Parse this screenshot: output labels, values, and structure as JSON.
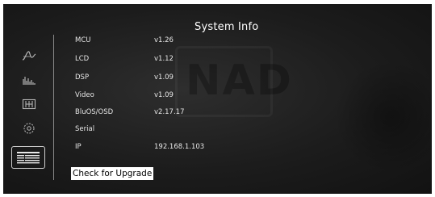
{
  "window": {
    "title": "System Info"
  },
  "sidebar": {
    "items": [
      {
        "name": "audio-wave-icon",
        "selected": false
      },
      {
        "name": "equalizer-icon",
        "selected": false
      },
      {
        "name": "speaker-setup-icon",
        "selected": false
      },
      {
        "name": "settings-gear-icon",
        "selected": false
      },
      {
        "name": "system-info-icon",
        "selected": true
      }
    ]
  },
  "info": {
    "rows": [
      {
        "label": "MCU",
        "value": "v1.26"
      },
      {
        "label": "LCD",
        "value": "v1.12"
      },
      {
        "label": "DSP",
        "value": "v1.09"
      },
      {
        "label": "Video",
        "value": "v1.09"
      },
      {
        "label": "BluOS/OSD",
        "value": "v2.17.17"
      },
      {
        "label": "Serial",
        "value": ""
      },
      {
        "label": "IP",
        "value": "192.168.1.103"
      }
    ]
  },
  "actions": {
    "upgrade_label": "Check for Upgrade"
  },
  "watermark": {
    "logo_text": "NAD"
  },
  "colors": {
    "background": "#1c1c1c",
    "text": "#e6e6e6",
    "icon": "#b5b5b5",
    "button_bg": "#ffffff",
    "button_text": "#000000"
  }
}
